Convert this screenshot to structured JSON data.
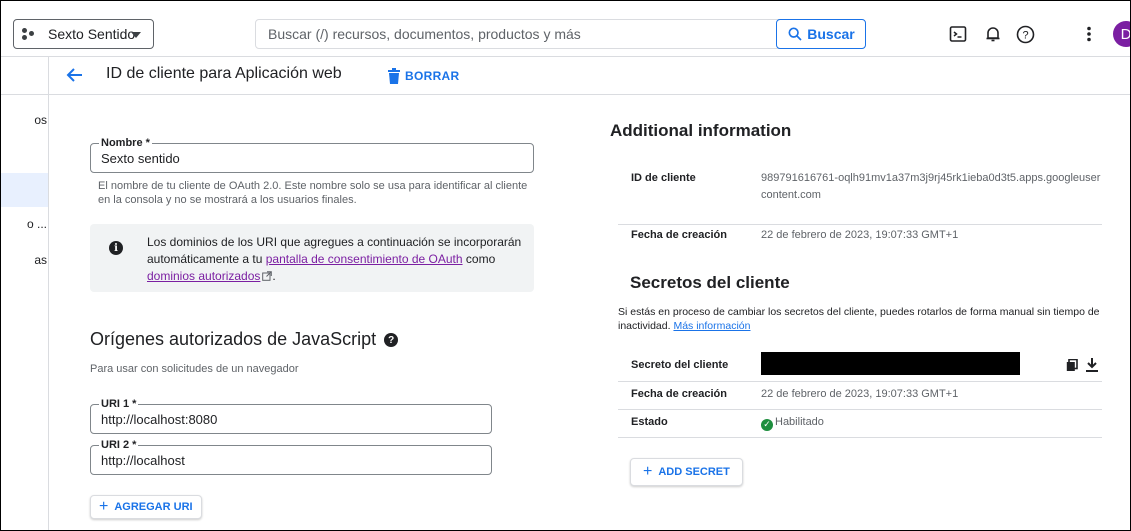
{
  "topbar": {
    "project_name": "Sexto Sentido",
    "search_placeholder": "Buscar (/) recursos, documentos, productos y más",
    "search_button": "Buscar",
    "avatar_letter": "D"
  },
  "subheader": {
    "title": "ID de cliente para Aplicación web",
    "delete_label": "BORRAR"
  },
  "leftrail": {
    "items": [
      "os",
      "o ...",
      "as"
    ]
  },
  "form": {
    "name_label": "Nombre *",
    "name_value": "Sexto sentido",
    "name_helper": "El nombre de tu cliente de OAuth 2.0. Este nombre solo se usa para identificar al cliente en la consola y no se mostrará a los usuarios finales.",
    "info_text_1": "Los dominios de los URI que agregues a continuación se incorporarán automáticamente a tu",
    "info_link_1": "pantalla de consentimiento de OAuth",
    "info_text_2": "como",
    "info_link_2": "dominios autorizados",
    "info_text_3": ".",
    "js_origins_title": "Orígenes autorizados de JavaScript",
    "js_origins_helper": "Para usar con solicitudes de un navegador",
    "uris": [
      {
        "label": "URI 1 *",
        "value": "http://localhost:8080"
      },
      {
        "label": "URI 2 *",
        "value": "http://localhost"
      }
    ],
    "add_uri_label": "AGREGAR URI"
  },
  "additional": {
    "title": "Additional information",
    "client_id_key": "ID de cliente",
    "client_id_value": "989791616761-oqlh91mv1a37m3j9rj45rk1ieba0d3t5.apps.googleusercontent.com",
    "created_key": "Fecha de creación",
    "created_value": "22 de febrero de 2023, 19:07:33 GMT+1"
  },
  "secrets": {
    "title": "Secretos del cliente",
    "helper": "Si estás en proceso de cambiar los secretos del cliente, puedes rotarlos de forma manual sin tiempo de inactividad.",
    "more_info": "Más información",
    "secret_key": "Secreto del cliente",
    "created_key": "Fecha de creación",
    "created_value": "22 de febrero de 2023, 19:07:33 GMT+1",
    "status_key": "Estado",
    "status_value": "Habilitado",
    "add_secret_label": "ADD SECRET"
  },
  "colors": {
    "accent": "#1a73e8",
    "link_visited": "#7b1fa2",
    "status_ok": "#1e8e3e"
  }
}
